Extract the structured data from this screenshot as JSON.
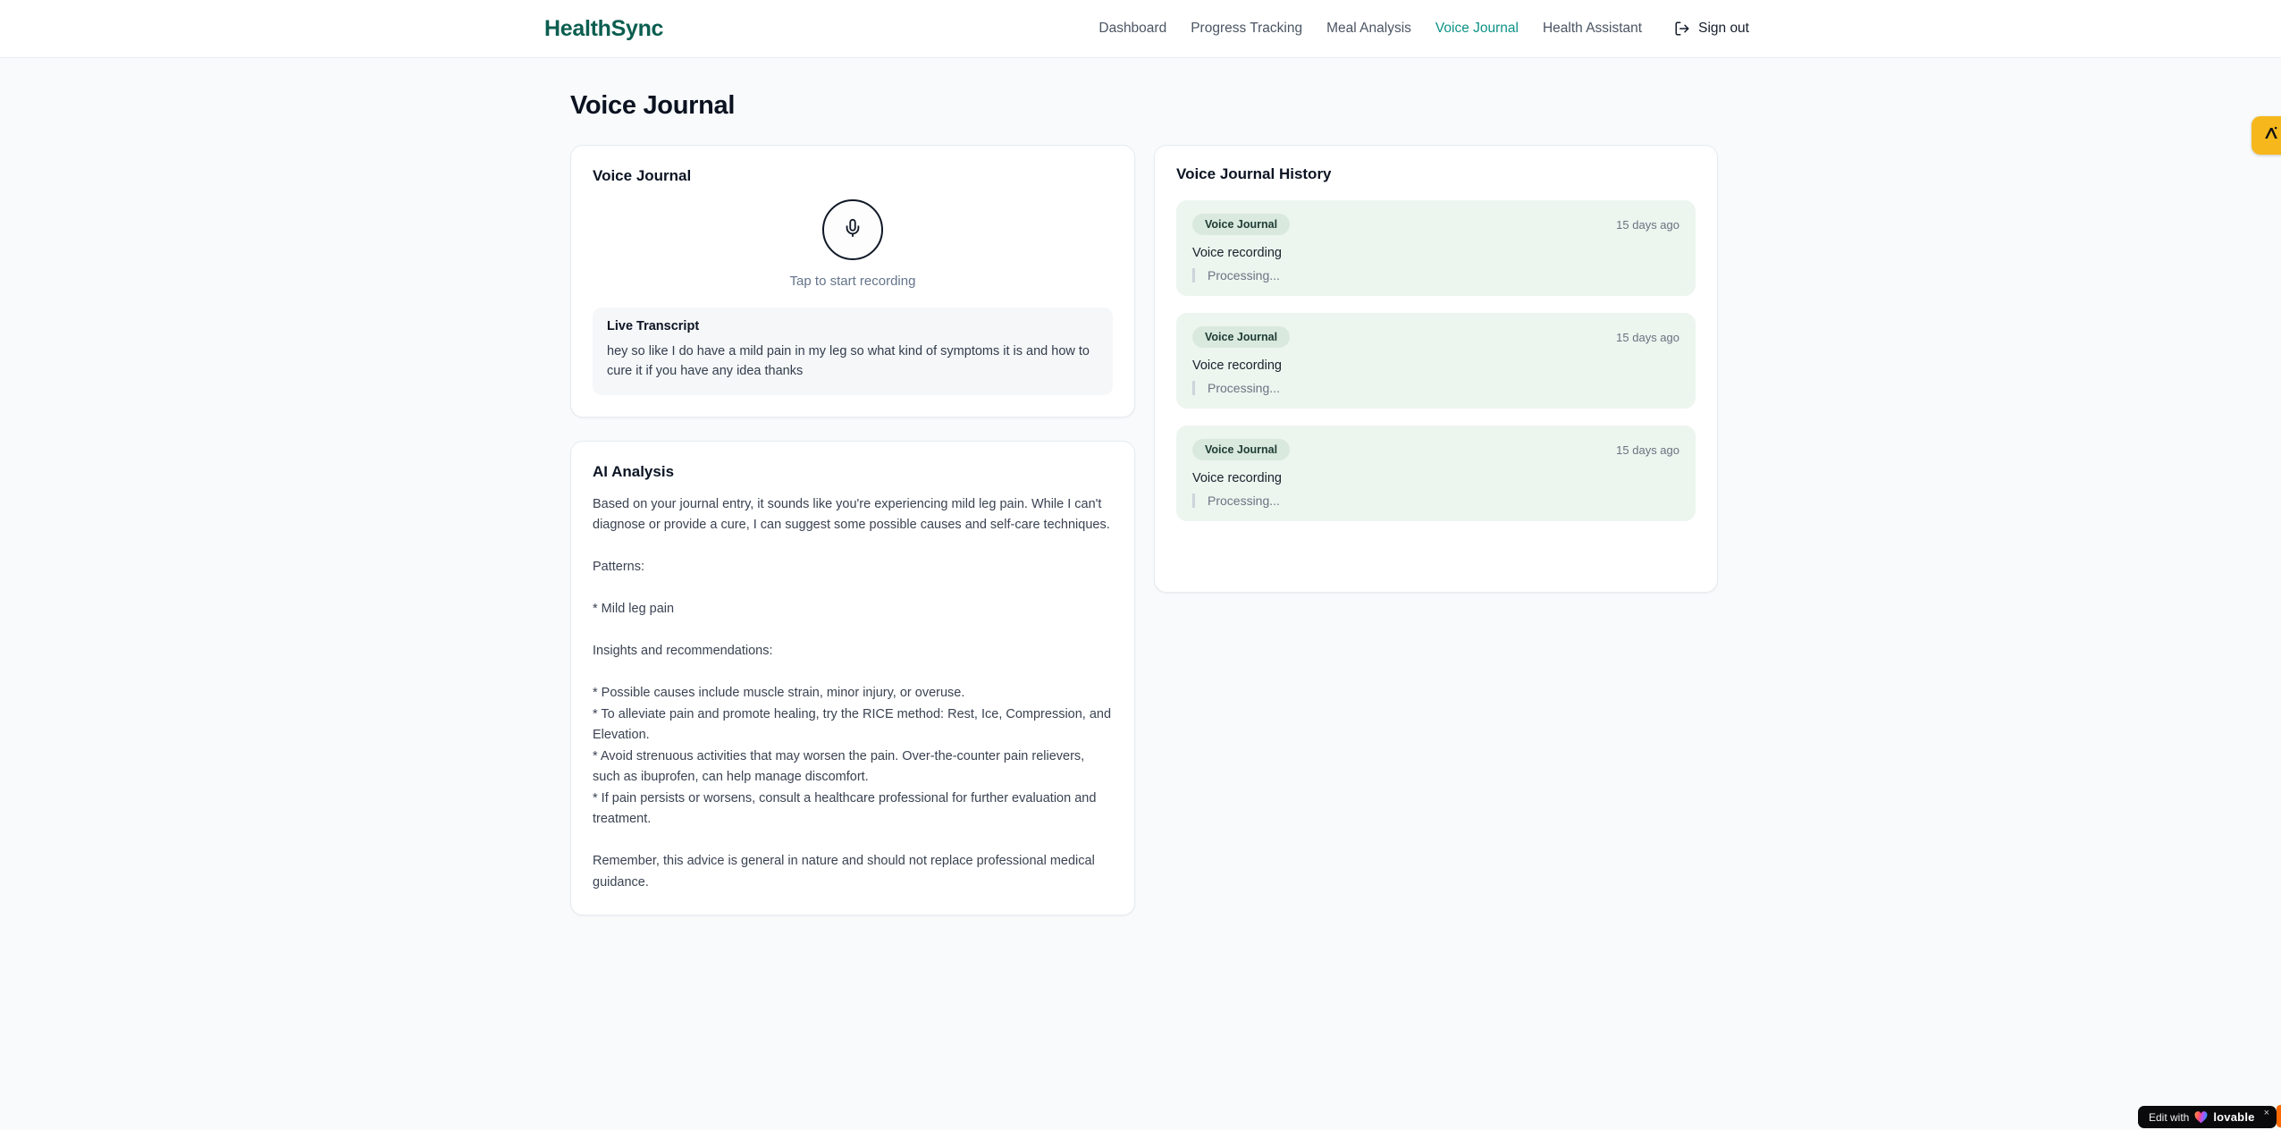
{
  "header": {
    "logo": "HealthSync",
    "nav": [
      {
        "label": "Dashboard"
      },
      {
        "label": "Progress Tracking"
      },
      {
        "label": "Meal Analysis"
      },
      {
        "label": "Voice Journal"
      },
      {
        "label": "Health Assistant"
      }
    ],
    "sign_out_label": "Sign out"
  },
  "page": {
    "title": "Voice Journal"
  },
  "recorder": {
    "card_title": "Voice Journal",
    "tap_hint": "Tap to start recording",
    "transcript_title": "Live Transcript",
    "transcript_text": "hey so like I do have a mild pain in my leg so what kind of symptoms it is and how to cure it if you have any idea thanks"
  },
  "analysis": {
    "card_title": "AI Analysis",
    "body": "Based on your journal entry, it sounds like you're experiencing mild leg pain. While I can't diagnose or provide a cure, I can suggest some possible causes and self-care techniques.\n\nPatterns:\n\n* Mild leg pain\n\nInsights and recommendations:\n\n* Possible causes include muscle strain, minor injury, or overuse.\n* To alleviate pain and promote healing, try the RICE method: Rest, Ice, Compression, and Elevation.\n* Avoid strenuous activities that may worsen the pain. Over-the-counter pain relievers, such as ibuprofen, can help manage discomfort.\n* If pain persists or worsens, consult a healthcare professional for further evaluation and treatment.\n\nRemember, this advice is general in nature and should not replace professional medical guidance."
  },
  "history": {
    "card_title": "Voice Journal History",
    "entries": [
      {
        "badge": "Voice Journal",
        "time": "15 days ago",
        "title": "Voice recording",
        "status": "Processing..."
      },
      {
        "badge": "Voice Journal",
        "time": "15 days ago",
        "title": "Voice recording",
        "status": "Processing..."
      },
      {
        "badge": "Voice Journal",
        "time": "15 days ago",
        "title": "Voice recording",
        "status": "Processing..."
      }
    ]
  },
  "widgets": {
    "edit_prefix": "Edit with",
    "edit_brand": "lovable",
    "edit_close": "×"
  },
  "colors": {
    "brand_green": "#0b5e50",
    "active_nav_teal": "#0d9286",
    "entry_mint": "#edf5ef",
    "badge_mint": "#d9e9dd",
    "amber": "#f5b71b",
    "page_bg": "#f8fafc"
  }
}
